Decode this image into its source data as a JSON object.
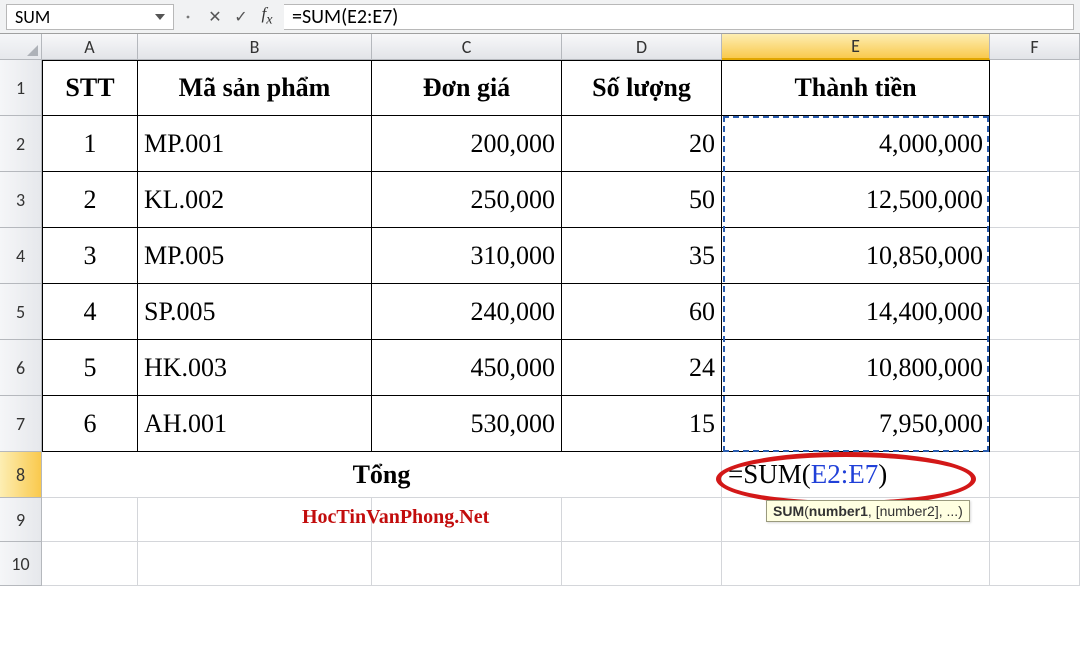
{
  "namebox": "SUM",
  "formula": "=SUM(E2:E7)",
  "columns": [
    "A",
    "B",
    "C",
    "D",
    "E",
    "F"
  ],
  "rows": [
    "1",
    "2",
    "3",
    "4",
    "5",
    "6",
    "7",
    "8",
    "9",
    "10"
  ],
  "header": {
    "stt": "STT",
    "ma": "Mã sản phẩm",
    "dongia": "Đơn giá",
    "soluong": "Số lượng",
    "thanhtien": "Thành tiền"
  },
  "data": [
    {
      "stt": "1",
      "ma": "MP.001",
      "dongia": "200,000",
      "sl": "20",
      "tt": "4,000,000"
    },
    {
      "stt": "2",
      "ma": "KL.002",
      "dongia": "250,000",
      "sl": "50",
      "tt": "12,500,000"
    },
    {
      "stt": "3",
      "ma": "MP.005",
      "dongia": "310,000",
      "sl": "35",
      "tt": "10,850,000"
    },
    {
      "stt": "4",
      "ma": "SP.005",
      "dongia": "240,000",
      "sl": "60",
      "tt": "14,400,000"
    },
    {
      "stt": "5",
      "ma": "HK.003",
      "dongia": "450,000",
      "sl": "24",
      "tt": "10,800,000"
    },
    {
      "stt": "6",
      "ma": "AH.001",
      "dongia": "530,000",
      "sl": "15",
      "tt": "7,950,000"
    }
  ],
  "total_label": "Tổng",
  "e8_formula": {
    "prefix": "=SUM(",
    "range": "E2:E7",
    "suffix": ")"
  },
  "tooltip": {
    "fn": "SUM",
    "sig": "(number1, [number2], ...)"
  },
  "watermark": "HocTinVanPhong.Net"
}
